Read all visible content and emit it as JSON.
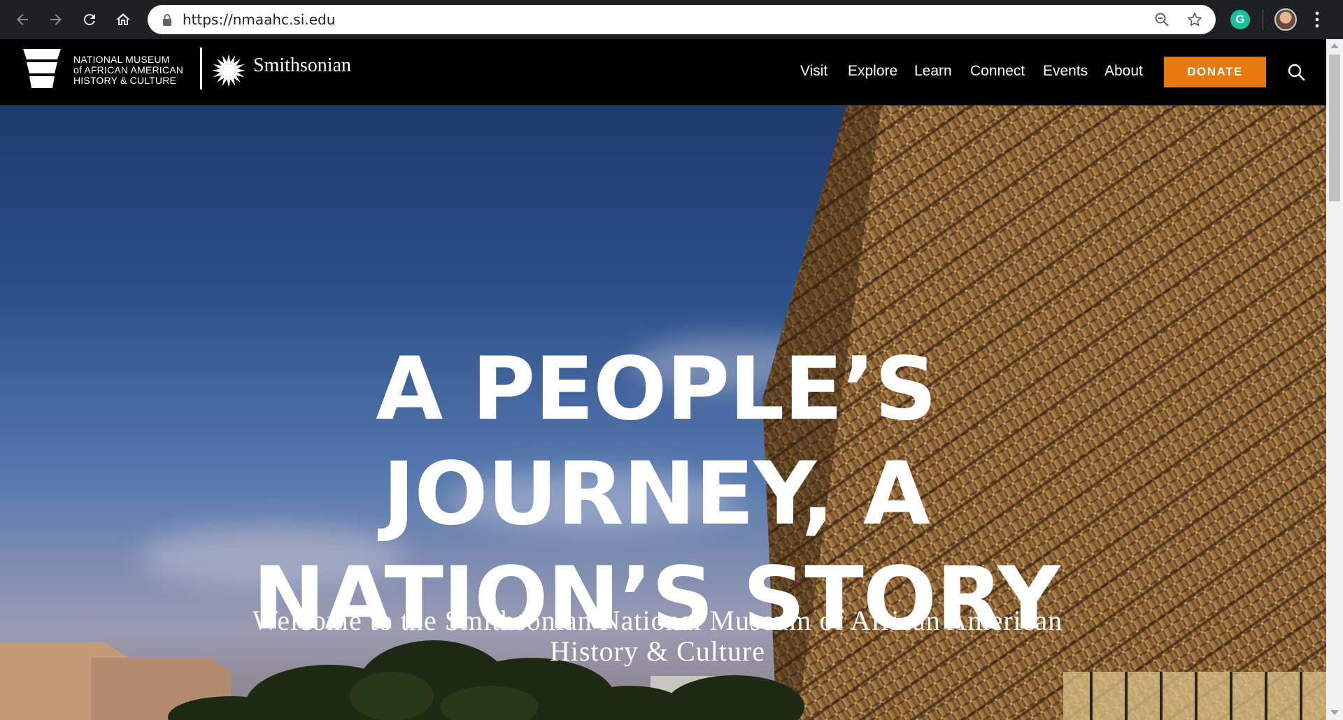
{
  "browser": {
    "url": "https://nmaahc.si.edu",
    "icons": {
      "back": "back-arrow-icon",
      "forward": "forward-arrow-icon",
      "reload": "reload-icon",
      "home": "home-icon",
      "lock": "lock-icon",
      "zoom": "zoom-icon",
      "bookmark": "star-icon",
      "extension": "grammarly-icon",
      "profile": "avatar",
      "menu": "kebab-menu-icon"
    },
    "extension_letter": "G"
  },
  "header": {
    "logo_lines": [
      "NATIONAL MUSEUM",
      "of AFRICAN AMERICAN",
      "HISTORY & CULTURE"
    ],
    "smithsonian": "Smithsonian",
    "nav": [
      "Visit",
      "Explore",
      "Learn",
      "Connect",
      "Events",
      "About"
    ],
    "donate": "DONATE",
    "colors": {
      "donate_bg": "#e8790e",
      "header_bg": "#000000"
    }
  },
  "hero": {
    "title_lines": [
      "A PEOPLE’S",
      "JOURNEY, A",
      "NATION’S STORY"
    ],
    "subtitle_lines": [
      "Welcome to the Smithsonian National Museum of African American",
      "History & Culture"
    ]
  }
}
